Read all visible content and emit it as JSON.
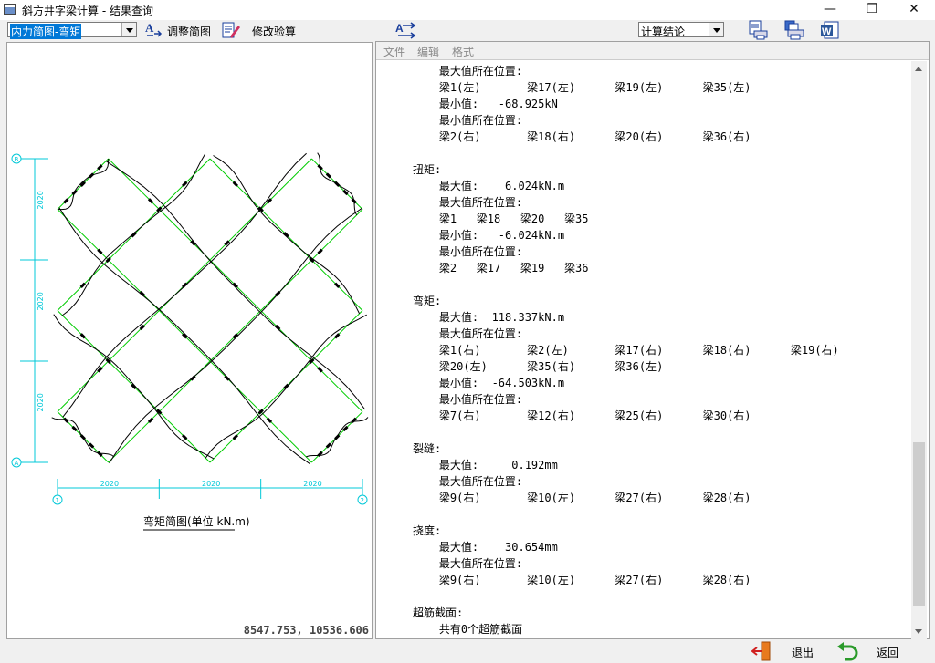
{
  "window": {
    "title": "斜方井字梁计算 - 结果查询",
    "minimize": "—",
    "restore": "❐",
    "close": "✕"
  },
  "toolbar": {
    "diagram_select": "内力简图-弯矩",
    "adjust_label": "调整简图",
    "modify_label": "修改验算",
    "result_select": "计算结论"
  },
  "diagram": {
    "caption": "弯矩简图(单位 kN.m)",
    "dim_labels": [
      "2020",
      "2020",
      "2020",
      "2020",
      "2020",
      "2020"
    ],
    "axis_labels": [
      "B",
      "A",
      "1",
      "2"
    ],
    "coords": "8547.753, 10536.606"
  },
  "menu": {
    "file": "文件",
    "edit": "编辑",
    "format": "格式"
  },
  "report_lines": [
    "    最大值所在位置:",
    "    梁1(左)       梁17(左)      梁19(左)      梁35(左)",
    "    最小值:   -68.925kN",
    "    最小值所在位置:",
    "    梁2(右)       梁18(右)      梁20(右)      梁36(右)",
    "",
    "扭矩:",
    "    最大值:    6.024kN.m",
    "    最大值所在位置:",
    "    梁1   梁18   梁20   梁35",
    "    最小值:   -6.024kN.m",
    "    最小值所在位置:",
    "    梁2   梁17   梁19   梁36",
    "",
    "弯矩:",
    "    最大值:  118.337kN.m",
    "    最大值所在位置:",
    "    梁1(右)       梁2(左)       梁17(右)      梁18(右)      梁19(右)",
    "    梁20(左)      梁35(右)      梁36(左)",
    "    最小值:  -64.503kN.m",
    "    最小值所在位置:",
    "    梁7(右)       梁12(右)      梁25(右)      梁30(右)",
    "",
    "裂缝:",
    "    最大值:     0.192mm",
    "    最大值所在位置:",
    "    梁9(右)       梁10(左)      梁27(右)      梁28(右)",
    "",
    "挠度:",
    "    最大值:    30.654mm",
    "    最大值所在位置:",
    "    梁9(右)       梁10(左)      梁27(右)      梁28(右)",
    "",
    "超筋截面:",
    "    共有0个超筋截面"
  ],
  "bottom": {
    "exit_label": "退出",
    "back_label": "返回"
  },
  "colors": {
    "dimension": "#00c8d8",
    "beam": "#00cc00",
    "moment": "#000000"
  }
}
